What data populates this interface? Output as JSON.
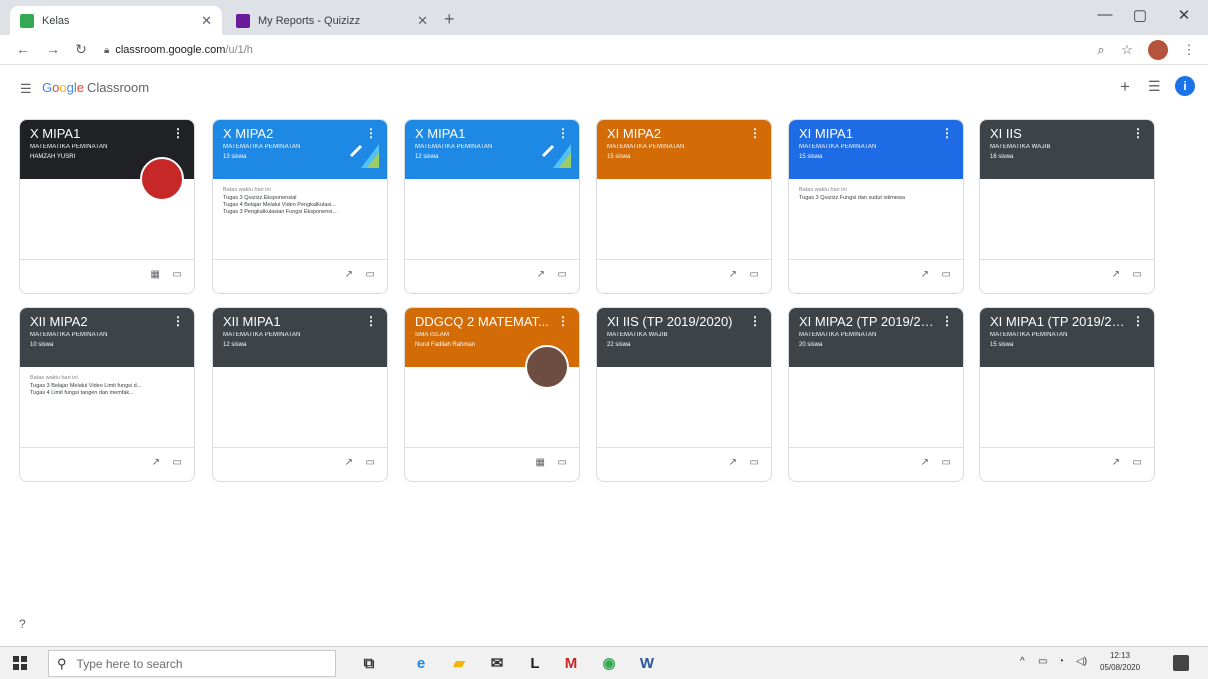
{
  "browser": {
    "tabs": [
      {
        "label": "Kelas",
        "favicon_color": "#34a853",
        "active": true
      },
      {
        "label": "My Reports - Quizizz",
        "favicon_color": "#6a1b9a",
        "active": false
      }
    ],
    "new_tab": "+",
    "url_host": "classroom.google.com",
    "url_path": "/u/1/h",
    "window": {
      "minimize": "—",
      "maximize": "▢",
      "close": "✕"
    }
  },
  "appbar": {
    "brand_parts": [
      "G",
      "o",
      "o",
      "g",
      "l",
      "e"
    ],
    "brand_suffix": "Classroom",
    "plus": "+",
    "grid": "☰",
    "avatar_letter": "i"
  },
  "cards": [
    {
      "name": "X MIPA1",
      "section": "MATEMATIKA PEMINATAN",
      "extra": "HAMZAH YUSRI",
      "color": "#202124",
      "tasks": [],
      "due": "",
      "icons": [
        "▦",
        "▭"
      ],
      "avatar": "#c62828"
    },
    {
      "name": "X MIPA2",
      "section": "MATEMATIKA PEMINATAN",
      "extra": "13 siswa",
      "color": "#1e88e5",
      "due": "Batas waktu hari ini",
      "tasks": [
        "Tugas 3 Quizizz Eksponensial",
        "Tugas 4 Belajar Melalui Video Pengkalkulasi...",
        "Tugas 3 Pengkalkulasian Fungsi Eksponensi..."
      ],
      "icons": [
        "↗",
        "▭"
      ],
      "deco": true
    },
    {
      "name": "X MIPA1",
      "section": "MATEMATIKA PEMINATAN",
      "extra": "12 siswa",
      "color": "#1e88e5",
      "due": "",
      "tasks": [],
      "icons": [
        "↗",
        "▭"
      ],
      "deco": true
    },
    {
      "name": "XI MIPA2",
      "section": "MATEMATIKA PEMINATAN",
      "extra": "15 siswa",
      "color": "#d36b07",
      "due": "",
      "tasks": [],
      "icons": [
        "↗",
        "▭"
      ]
    },
    {
      "name": "XI MIPA1",
      "section": "MATEMATIKA PEMINATAN",
      "extra": "15 siswa",
      "color": "#1e6be6",
      "due": "Batas waktu hari ini",
      "tasks": [
        "Tugas 3 Quizizz Fungsi dan sudut istimewa"
      ],
      "icons": [
        "↗",
        "▭"
      ]
    },
    {
      "name": "XI IIS",
      "section": "MATEMATIKA WAJIB",
      "extra": "16 siswa",
      "color": "#3d4347",
      "due": "",
      "tasks": [],
      "icons": [
        "↗",
        "▭"
      ]
    },
    {
      "name": "XII MIPA2",
      "section": "MATEMATIKA PEMINATAN",
      "extra": "10 siswa",
      "color": "#3d4347",
      "due": "Batas waktu hari ini",
      "tasks": [
        "Tugas 3 Belajar Melalui Video Limit fungsi d...",
        "Tugas 4 Limit fungsi tangen dan memfak..."
      ],
      "icons": [
        "↗",
        "▭"
      ]
    },
    {
      "name": "XII MIPA1",
      "section": "MATEMATIKA PEMINATAN",
      "extra": "12 siswa",
      "color": "#3d4347",
      "due": "",
      "tasks": [],
      "icons": [
        "↗",
        "▭"
      ]
    },
    {
      "name": "DDGCQ 2 MATEMAT...",
      "section": "SMA ISLAM",
      "extra": "Nurul Fadilah Rahman",
      "color": "#d36b07",
      "due": "",
      "tasks": [],
      "icons": [
        "▦",
        "▭"
      ],
      "avatar": "#6d4c41"
    },
    {
      "name": "XI IIS (TP 2019/2020)",
      "section": "MATEMATIKA WAJIB",
      "extra": "22 siswa",
      "color": "#3d4347",
      "due": "",
      "tasks": [],
      "icons": [
        "↗",
        "▭"
      ]
    },
    {
      "name": "XI MIPA2 (TP 2019/20...",
      "section": "MATEMATIKA PEMINATAN",
      "extra": "20 siswa",
      "color": "#3d4347",
      "due": "",
      "tasks": [],
      "icons": [
        "↗",
        "▭"
      ]
    },
    {
      "name": "XI MIPA1 (TP 2019/20...",
      "section": "MATEMATIKA PEMINATAN",
      "extra": "15 siswa",
      "color": "#3d4347",
      "due": "",
      "tasks": [],
      "icons": [
        "↗",
        "▭"
      ]
    }
  ],
  "help": "?",
  "taskbar": {
    "search_placeholder": "Type here to search",
    "apps": [
      {
        "icon": "task-view-icon",
        "glyph": "⧉",
        "color": "#333"
      },
      {
        "icon": "edge-icon",
        "glyph": "e",
        "color": "#1e88e5"
      },
      {
        "icon": "file-explorer-icon",
        "glyph": "▰",
        "color": "#f4b400"
      },
      {
        "icon": "mail-icon",
        "glyph": "✉",
        "color": "#333"
      },
      {
        "icon": "l-app-icon",
        "glyph": "L",
        "color": "#222"
      },
      {
        "icon": "mcafee-icon",
        "glyph": "M",
        "color": "#c62828"
      },
      {
        "icon": "chrome-icon",
        "glyph": "◉",
        "color": "#34a853"
      },
      {
        "icon": "word-icon",
        "glyph": "W",
        "color": "#2b579a"
      }
    ],
    "time": "12:13",
    "date": "05/08/2020"
  }
}
